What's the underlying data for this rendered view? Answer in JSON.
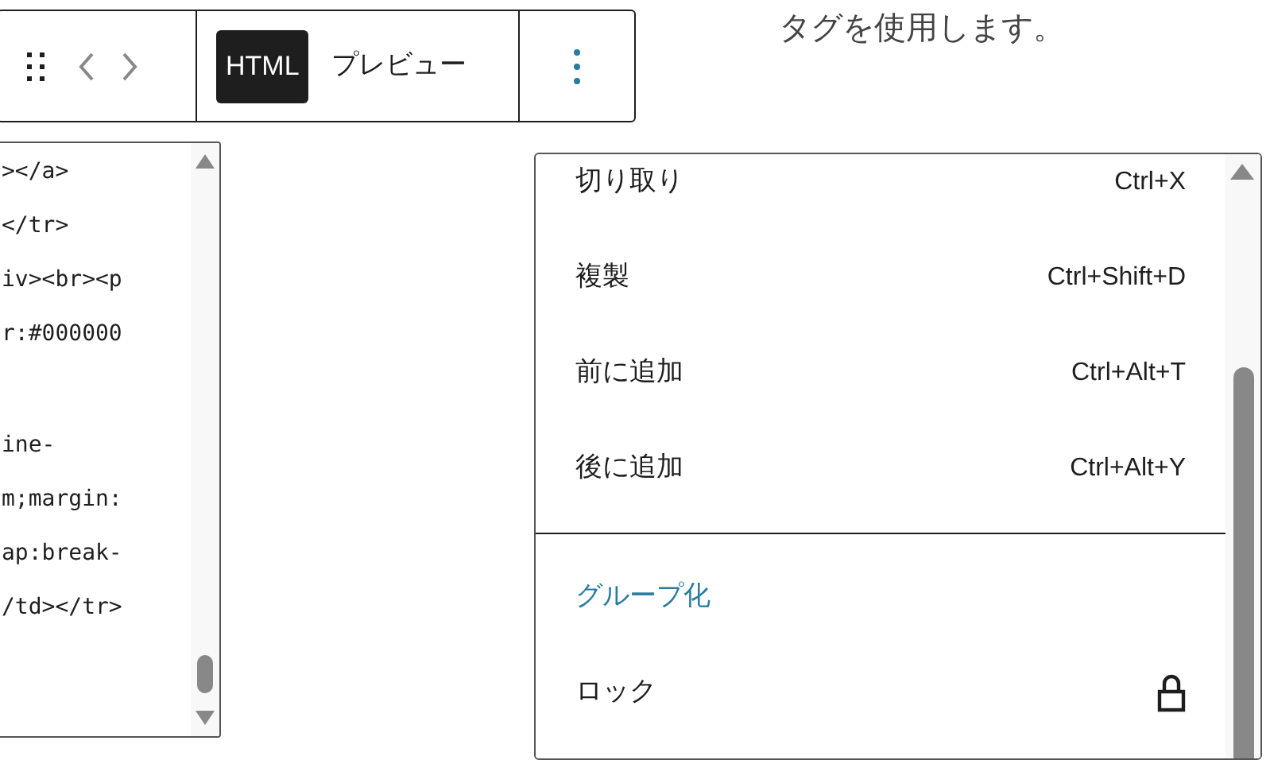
{
  "background_text": "タグを使用します。",
  "toolbar": {
    "view_tabs": [
      {
        "label": "HTML",
        "selected": true
      },
      {
        "label": "プレビュー",
        "selected": false
      }
    ]
  },
  "code_editor": {
    "blocks": [
      [
        "></a>",
        "</tr>",
        "iv><br><p",
        "r:#000000"
      ],
      [
        "ine-",
        "m;margin:",
        "ap:break-",
        "/td></tr>"
      ]
    ]
  },
  "menu": {
    "items": [
      {
        "kind": "shortcut",
        "label": "切り取り",
        "shortcut": "Ctrl+X"
      },
      {
        "kind": "shortcut",
        "label": "複製",
        "shortcut": "Ctrl+Shift+D"
      },
      {
        "kind": "shortcut",
        "label": "前に追加",
        "shortcut": "Ctrl+Alt+T"
      },
      {
        "kind": "shortcut",
        "label": "後に追加",
        "shortcut": "Ctrl+Alt+Y"
      },
      {
        "kind": "divider"
      },
      {
        "kind": "accent",
        "label": "グループ化"
      },
      {
        "kind": "lock",
        "label": "ロック"
      }
    ]
  }
}
